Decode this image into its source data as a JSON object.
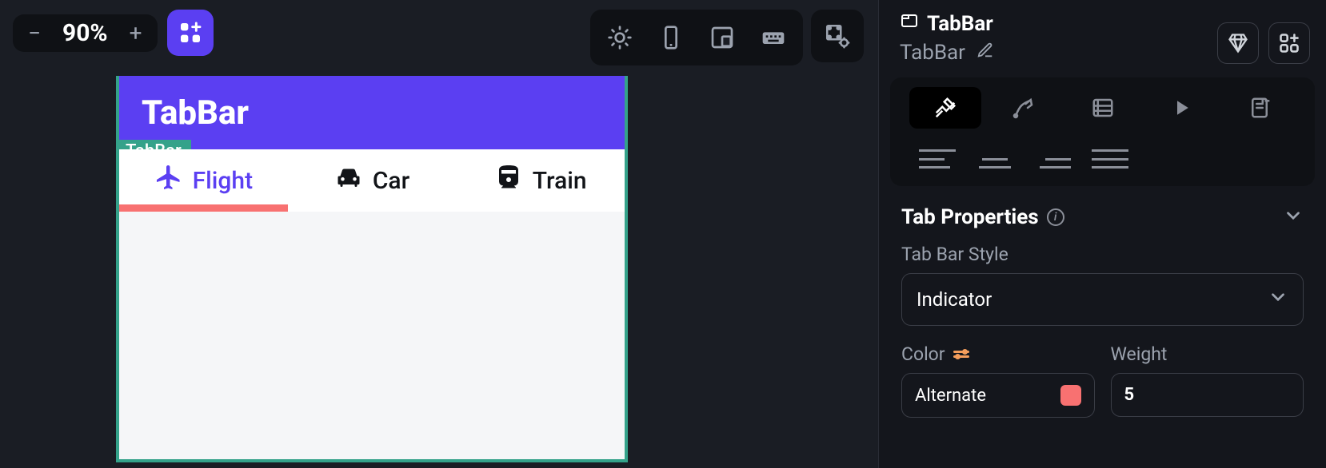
{
  "toolbar": {
    "zoom": "90%"
  },
  "preview": {
    "header_title": "TabBar",
    "selection_tag": "TabBar",
    "tabs": [
      {
        "label": "Flight",
        "icon": "airplane",
        "active": true
      },
      {
        "label": "Car",
        "icon": "car",
        "active": false
      },
      {
        "label": "Train",
        "icon": "train",
        "active": false
      }
    ],
    "indicator_color": "#f87171"
  },
  "panel": {
    "component_name": "TabBar",
    "subtitle": "TabBar",
    "section_title": "Tab Properties",
    "fields": {
      "tab_bar_style_label": "Tab Bar Style",
      "tab_bar_style_value": "Indicator",
      "color_label": "Color",
      "color_value": "Alternate",
      "color_hex": "#f87171",
      "weight_label": "Weight",
      "weight_value": "5"
    }
  }
}
